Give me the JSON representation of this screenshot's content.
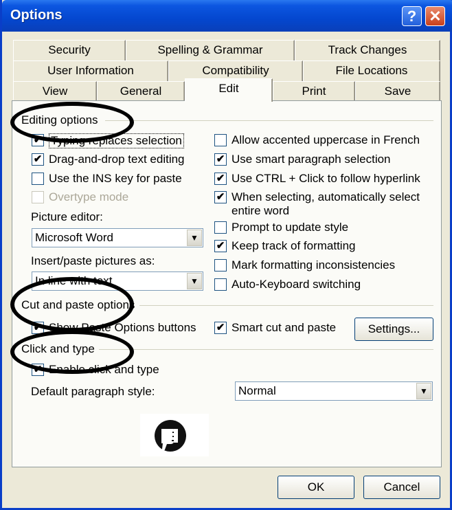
{
  "window": {
    "title": "Options"
  },
  "titlebar": {
    "help_glyph": "?",
    "close_glyph": "✕"
  },
  "tabs": {
    "row1": [
      "Security",
      "Spelling & Grammar",
      "Track Changes"
    ],
    "row2": [
      "User Information",
      "Compatibility",
      "File Locations"
    ],
    "row3": [
      "View",
      "General",
      "Edit",
      "Print",
      "Save"
    ],
    "active": "Edit"
  },
  "editing": {
    "label": "Editing options",
    "left": [
      {
        "label": "Typing replaces selection",
        "checked": true,
        "enabled": true
      },
      {
        "label": "Drag-and-drop text editing",
        "checked": true,
        "enabled": true
      },
      {
        "label": "Use the INS key for paste",
        "checked": false,
        "enabled": true
      },
      {
        "label": "Overtype mode",
        "checked": false,
        "enabled": false
      }
    ],
    "right": [
      {
        "label": "Allow accented uppercase in French",
        "checked": false
      },
      {
        "label": "Use smart paragraph selection",
        "checked": true
      },
      {
        "label": "Use CTRL + Click to follow hyperlink",
        "checked": true
      },
      {
        "label": "When selecting, automatically select",
        "label2": "entire word",
        "checked": true
      },
      {
        "label": "Prompt to update style",
        "checked": false
      },
      {
        "label": "Keep track of formatting",
        "checked": true
      },
      {
        "label": "Mark formatting inconsistencies",
        "checked": false
      },
      {
        "label": "Auto-Keyboard switching",
        "checked": false
      }
    ],
    "picture_editor_label": "Picture editor:",
    "picture_editor_value": "Microsoft Word",
    "insert_paste_label": "Insert/paste pictures as:",
    "insert_paste_value": "In line with text"
  },
  "cut_paste": {
    "label": "Cut and paste options",
    "show_buttons_label": "Show Paste Options buttons",
    "show_buttons_checked": true,
    "smart_label": "Smart cut and paste",
    "smart_checked": true,
    "settings_button": "Settings..."
  },
  "click_type": {
    "label": "Click and type",
    "enable_label": "Enable click and type",
    "enable_checked": true,
    "default_style_label": "Default paragraph style:",
    "default_style_value": "Normal"
  },
  "footer": {
    "ok": "OK",
    "cancel": "Cancel"
  },
  "check_glyph": "✔",
  "arrow_glyph": "▼",
  "thumb_icon": "thumbs-down-icon"
}
